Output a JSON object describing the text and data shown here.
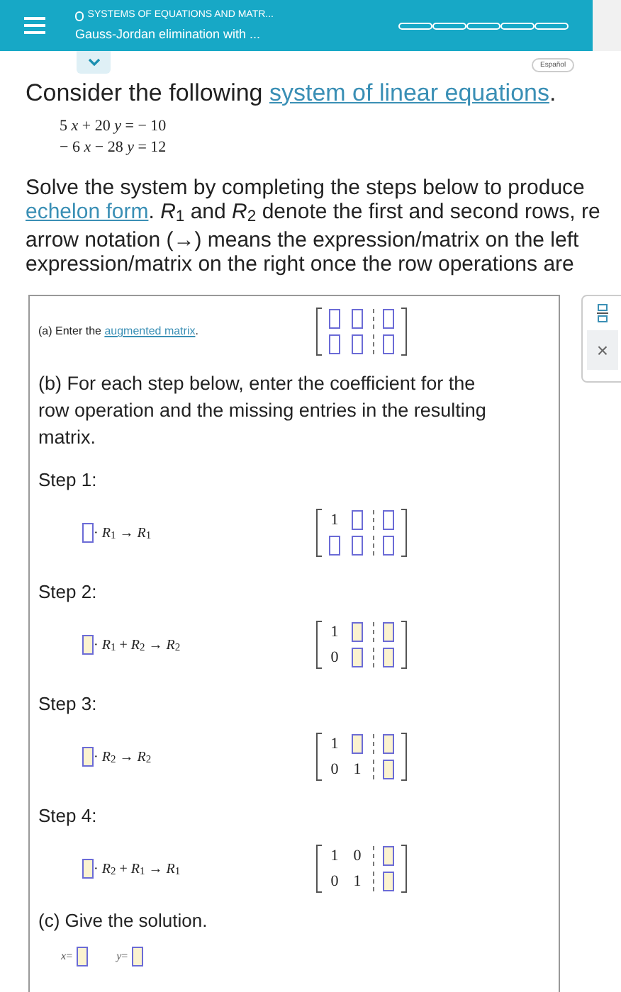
{
  "header": {
    "section": "SYSTEMS OF EQUATIONS AND MATR...",
    "title": "Gauss-Jordan elimination with ...",
    "progress_segments": [
      {
        "filled": false
      },
      {
        "filled": false
      },
      {
        "filled": false
      },
      {
        "filled": false
      },
      {
        "filled": false
      }
    ]
  },
  "language_button": "Español",
  "heading": {
    "text": "Consider the following ",
    "link": "system of linear equations",
    "end": "."
  },
  "equations": [
    "5 *x* + 20 *y* = − 10",
    "− 6 *x* − 28 *y* = 12"
  ],
  "instructions": [
    {
      "text": "Solve the system by completing the steps below to produce"
    },
    {
      "link": "echelon form",
      "text": ". *R*$_{1}$ and *R*$_{2}$ denote the first and second rows, re"
    },
    {
      "text": "arrow notation (→) means the expression/matrix on the left"
    },
    {
      "text": "expression/matrix on the right once the row operations are"
    }
  ],
  "part_a": {
    "label": "(a) Enter the ",
    "link": "augmented matrix",
    "end": ".",
    "highlighted": false,
    "matrix": [
      [
        {
          "kind": "input"
        },
        {
          "kind": "input"
        },
        {
          "kind": "input"
        }
      ],
      [
        {
          "kind": "input"
        },
        {
          "kind": "input"
        },
        {
          "kind": "input"
        }
      ]
    ]
  },
  "part_b": "(b) For each step below, enter the coefficient for the row operation and the missing entries in the resulting matrix.",
  "steps": [
    {
      "label": "Step 1:",
      "highlighted": false,
      "operation": "· *R*$_{1}$ → *R*$_{1}$",
      "matrix": [
        [
          {
            "kind": "value",
            "text": "1"
          },
          {
            "kind": "input"
          },
          {
            "kind": "input"
          }
        ],
        [
          {
            "kind": "input"
          },
          {
            "kind": "input"
          },
          {
            "kind": "input"
          }
        ]
      ]
    },
    {
      "label": "Step 2:",
      "highlighted": true,
      "operation": "· *R*$_{1}$ + *R*$_{2}$ → *R*$_{2}$",
      "matrix": [
        [
          {
            "kind": "value",
            "text": "1"
          },
          {
            "kind": "input"
          },
          {
            "kind": "input"
          }
        ],
        [
          {
            "kind": "value",
            "text": "0"
          },
          {
            "kind": "input"
          },
          {
            "kind": "input"
          }
        ]
      ]
    },
    {
      "label": "Step 3:",
      "highlighted": true,
      "operation": "· *R*$_{2}$ → *R*$_{2}$",
      "matrix": [
        [
          {
            "kind": "value",
            "text": "1"
          },
          {
            "kind": "input"
          },
          {
            "kind": "input"
          }
        ],
        [
          {
            "kind": "value",
            "text": "0"
          },
          {
            "kind": "value",
            "text": "1"
          },
          {
            "kind": "input"
          }
        ]
      ]
    },
    {
      "label": "Step 4:",
      "highlighted": true,
      "operation": "· *R*$_{2}$ + *R*$_{1}$ → *R*$_{1}$",
      "matrix": [
        [
          {
            "kind": "value",
            "text": "1"
          },
          {
            "kind": "value",
            "text": "0"
          },
          {
            "kind": "input"
          }
        ],
        [
          {
            "kind": "value",
            "text": "0"
          },
          {
            "kind": "value",
            "text": "1"
          },
          {
            "kind": "input"
          }
        ]
      ]
    }
  ],
  "part_c": {
    "label": "(c) Give the solution.",
    "highlighted": true,
    "answers": [
      {
        "variable": "*x*="
      },
      {
        "variable": "*y*="
      }
    ]
  },
  "side_tools": {
    "close": "×"
  }
}
